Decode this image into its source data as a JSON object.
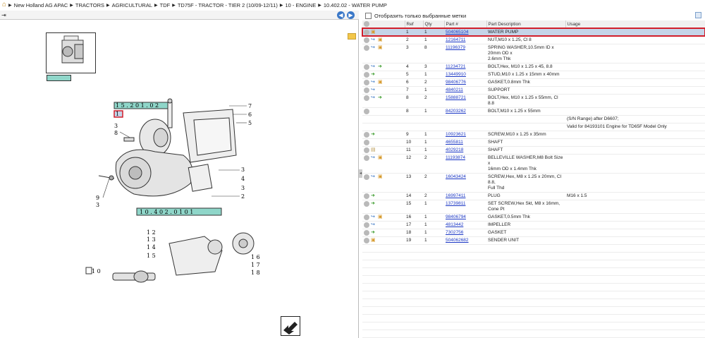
{
  "breadcrumb": [
    "New Holland AG APAC",
    "TRACTORS",
    "AGRICULTURAL",
    "TDF",
    "TD75F - TRACTOR - TIER 2 (10/09-12/11)",
    "10 - ENGINE",
    "10.402.02 - WATER PUMP"
  ],
  "filter_label": "Отобразить только выбранные метки",
  "columns": [
    "Ref",
    "Qty",
    "Part #",
    "Part Description",
    "Usage"
  ],
  "diagram": {
    "group_code": "1 5 . 2 0 1 . 0 2",
    "page_code": "1 0 . 4 0 2 . 0 1     0 1",
    "refs_right_top": [
      "7",
      "6",
      "5"
    ],
    "refs_right_mid": [
      "3",
      "4",
      "3",
      "2"
    ],
    "refs_left": [
      "1",
      "3",
      "8",
      "9",
      "3"
    ],
    "refs_sub_left": [
      "1 2",
      "1 3",
      "1 4",
      "1 5"
    ],
    "refs_sub_right": [
      "1 6",
      "1 7",
      "1 8"
    ],
    "ref_shaft": "1 0"
  },
  "rows": [
    {
      "icons": [
        "box"
      ],
      "ref": "1",
      "qty": "1",
      "part": "504065104",
      "desc": [
        "WATER PUMP"
      ],
      "usage": "",
      "selected": true
    },
    {
      "icons": [
        "blue",
        "box"
      ],
      "ref": "2",
      "qty": "1",
      "part": "12164711",
      "desc": [
        "NUT,M10 x 1.25, Cl 8"
      ],
      "usage": ""
    },
    {
      "icons": [
        "blue",
        "box"
      ],
      "ref": "3",
      "qty": "8",
      "part": "11196379",
      "desc": [
        "SPRING WASHER,10.5mm ID x 20mm OD x",
        "2.6mm Thk"
      ],
      "usage": ""
    },
    {
      "icons": [
        "blue",
        "green"
      ],
      "ref": "4",
      "qty": "3",
      "part": "11234721",
      "desc": [
        "BOLT,Hex, M10 x 1.25 x 45, 8.8"
      ],
      "usage": ""
    },
    {
      "icons": [
        "green"
      ],
      "ref": "5",
      "qty": "1",
      "part": "13449910",
      "desc": [
        "STUD,M10 x 1.25 x 15mm x 40mm"
      ],
      "usage": ""
    },
    {
      "icons": [
        "blue",
        "box"
      ],
      "ref": "6",
      "qty": "2",
      "part": "98406776",
      "desc": [
        "GASKET,0.8mm Thk"
      ],
      "usage": ""
    },
    {
      "icons": [
        "blue"
      ],
      "ref": "7",
      "qty": "1",
      "part": "4840211",
      "desc": [
        "SUPPORT"
      ],
      "usage": ""
    },
    {
      "icons": [
        "blue",
        "green"
      ],
      "ref": "8",
      "qty": "2",
      "part": "15888721",
      "desc": [
        "BOLT,Hex, M10 x 1.25 x 55mm, Cl 8.8"
      ],
      "usage": ""
    },
    {
      "icons": [],
      "ref": "8",
      "qty": "1",
      "part": "84203262",
      "desc": [
        "BOLT,M10 x 1.25 x 55mm"
      ],
      "usage": ""
    },
    {
      "icons": null,
      "ref": "",
      "qty": "",
      "part": "",
      "desc": [],
      "usage": "(S/N Range) after D6607;"
    },
    {
      "icons": null,
      "ref": "",
      "qty": "",
      "part": "",
      "desc": [],
      "usage": "Valid for 84193101 Engine for TD65F Model Only"
    },
    {
      "icons": [
        "green"
      ],
      "ref": "9",
      "qty": "1",
      "part": "10923621",
      "desc": [
        "SCREW,M10 x 1.25 x 35mm"
      ],
      "usage": ""
    },
    {
      "icons": [],
      "ref": "10",
      "qty": "1",
      "part": "4655811",
      "desc": [
        "SHAFT"
      ],
      "usage": ""
    },
    {
      "icons": [
        "note"
      ],
      "ref": "11",
      "qty": "1",
      "part": "4029218",
      "desc": [
        "SHAFT"
      ],
      "usage": ""
    },
    {
      "icons": [
        "blue",
        "box"
      ],
      "ref": "12",
      "qty": "2",
      "part": "11193874",
      "desc": [
        "BELLEVILLE WASHER,M8 Bolt Size x",
        "16mm OD x 1.4mm Thk"
      ],
      "usage": ""
    },
    {
      "icons": [
        "blue",
        "box"
      ],
      "ref": "13",
      "qty": "2",
      "part": "16043424",
      "desc": [
        "SCREW,Hex, M8 x 1.25 x 20mm, Cl 8.8,",
        "Full Thd"
      ],
      "usage": ""
    },
    {
      "icons": [
        "green"
      ],
      "ref": "14",
      "qty": "2",
      "part": "16997411",
      "desc": [
        "PLUG"
      ],
      "usage": "M16 x 1.5"
    },
    {
      "icons": [
        "green"
      ],
      "ref": "15",
      "qty": "1",
      "part": "13739811",
      "desc": [
        "SET SCREW,Hex Skt, M8 x 16mm, Cone Pt"
      ],
      "usage": ""
    },
    {
      "icons": [
        "blue",
        "box"
      ],
      "ref": "16",
      "qty": "1",
      "part": "98406794",
      "desc": [
        "GASKET,0.5mm Thk"
      ],
      "usage": ""
    },
    {
      "icons": [
        "blue"
      ],
      "ref": "17",
      "qty": "1",
      "part": "4813442",
      "desc": [
        "IMPELLER"
      ],
      "usage": ""
    },
    {
      "icons": [
        "green"
      ],
      "ref": "18",
      "qty": "1",
      "part": "7302756",
      "desc": [
        "GASKET"
      ],
      "usage": ""
    },
    {
      "icons": [
        "box"
      ],
      "ref": "19",
      "qty": "1",
      "part": "504062682",
      "desc": [
        "SENDER UNIT"
      ],
      "usage": ""
    }
  ]
}
